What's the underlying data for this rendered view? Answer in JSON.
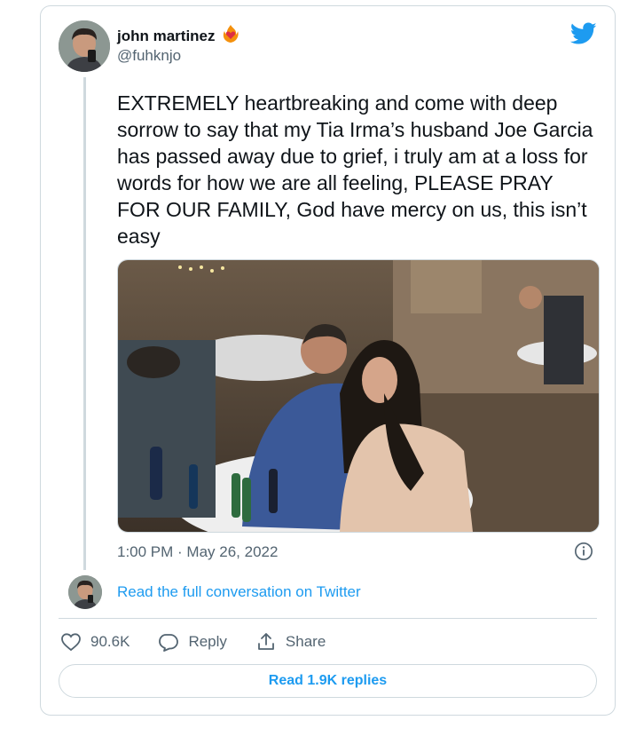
{
  "tweet": {
    "author_name": "john martinez",
    "author_handle": "@fuhknjo",
    "badge_icon": "heart-on-fire-emoji",
    "text": "EXTREMELY heartbreaking and come with deep sorrow to say that my Tia Irma’s husband Joe Garcia has passed away due to grief, i truly am at a loss for words for how we are all feeling, PLEASE PRAY FOR OUR FAMILY, God have mercy on us, this isn’t easy",
    "timestamp": "1:00 PM · May 26, 2022"
  },
  "conversation_link": "Read the full conversation on Twitter",
  "actions": {
    "likes": "90.6K",
    "reply_label": "Reply",
    "share_label": "Share"
  },
  "replies_button": "Read 1.9K replies",
  "colors": {
    "accent": "#1d9bf0",
    "border": "#cfd9de",
    "secondary_text": "#536471"
  }
}
